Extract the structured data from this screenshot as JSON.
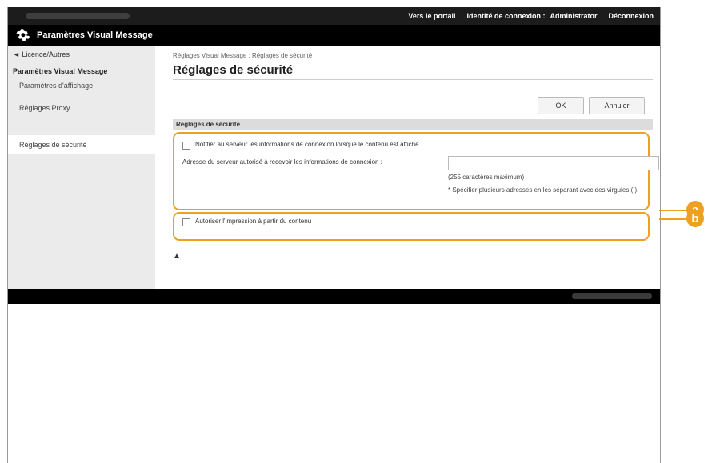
{
  "topbar": {
    "portal_link": "Vers le portail",
    "login_identity": "Identité de connexion :",
    "user": "Administrator",
    "logout": "Déconnexion"
  },
  "app": {
    "title": "Paramètres Visual Message"
  },
  "sidebar": {
    "back": "◄ Licence/Autres",
    "group": "Paramètres Visual Message",
    "items": [
      {
        "label": "Paramètres d'affichage"
      },
      {
        "label": "Réglages Proxy"
      },
      {
        "label": "Réglages de sécurité"
      }
    ]
  },
  "main": {
    "breadcrumb": "Réglages Visual Message : Réglages de sécurité",
    "title": "Réglages de sécurité",
    "ok": "OK",
    "cancel": "Annuler",
    "section": "Réglages de sécurité",
    "notify_label": "Notifier au serveur les informations de connexion lorsque le contenu est affiché",
    "server_address_label": "Adresse du serveur autorisé à recevoir les informations de connexion :",
    "server_address_value": "",
    "max_chars": "(255 caractères maximum)",
    "multi_note": "* Spécifier plusieurs adresses en les séparant avec des virgules (,).",
    "print_label": "Autoriser l'impression à partir du contenu",
    "top_link": "▲"
  },
  "callouts": {
    "a": "a",
    "b": "b"
  },
  "colors": {
    "accent": "#f0a020",
    "topbar": "#1c1c1c",
    "sidebar": "#ebebeb"
  }
}
